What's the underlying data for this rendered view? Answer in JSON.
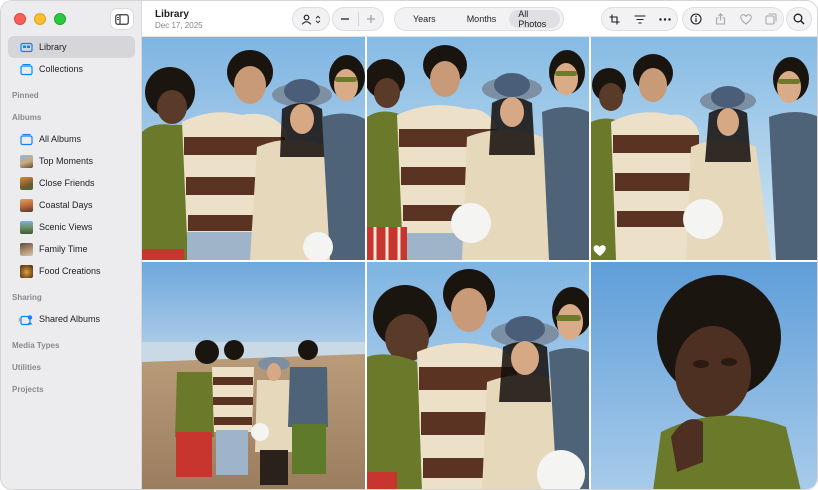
{
  "sidebar": {
    "library": "Library",
    "collections": "Collections",
    "sections": {
      "pinned": "Pinned",
      "albums": "Albums",
      "sharing": "Sharing",
      "media_types": "Media Types",
      "utilities": "Utilities",
      "projects": "Projects"
    },
    "albums": [
      {
        "label": "All Albums"
      },
      {
        "label": "Top Moments"
      },
      {
        "label": "Close Friends"
      },
      {
        "label": "Coastal Days"
      },
      {
        "label": "Scenic Views"
      },
      {
        "label": "Family Time"
      },
      {
        "label": "Food Creations"
      }
    ],
    "shared_albums": "Shared Albums"
  },
  "toolbar": {
    "title": "Library",
    "date": "Dec 17, 2025",
    "view_tabs": [
      "Years",
      "Months",
      "All Photos"
    ],
    "active_tab": "All Photos"
  },
  "colors": {
    "accent": "#0a84ff",
    "sidebar_bg": "#ececee",
    "selected_bg": "#d6d6da"
  },
  "icons": [
    "sidebar-toggle-icon",
    "person-icon",
    "chevron-updown-icon",
    "minus-icon",
    "plus-icon",
    "crop-icon",
    "filter-icon",
    "more-icon",
    "info-icon",
    "share-icon",
    "heart-icon",
    "duplicate-icon",
    "search-icon"
  ]
}
